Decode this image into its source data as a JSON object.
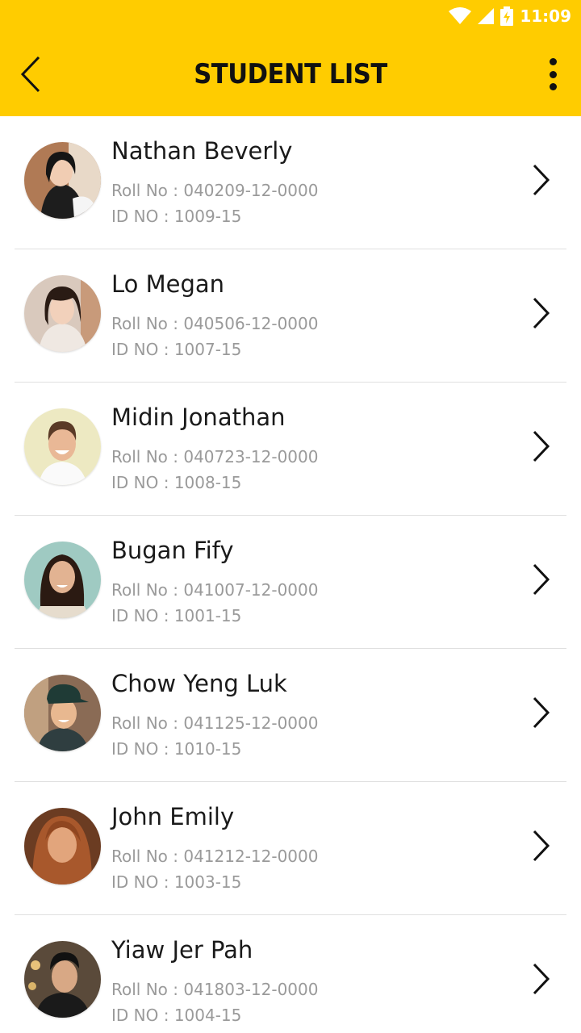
{
  "status_bar": {
    "time": "11:09"
  },
  "header": {
    "title": "STUDENT LIST",
    "accent_color": "#FFCC00"
  },
  "icons": {
    "back": "chevron-left-icon",
    "more": "more-vert-icon",
    "row_action": "chevron-right-icon",
    "wifi": "wifi-icon",
    "signal": "signal-icon",
    "battery": "battery-charging-icon"
  },
  "students": [
    {
      "name": "Nathan Beverly",
      "roll": "Roll No : 040209-12-0000",
      "id": "ID NO : 1009-15"
    },
    {
      "name": "Lo Megan",
      "roll": "Roll No : 040506-12-0000",
      "id": "ID NO : 1007-15"
    },
    {
      "name": "Midin Jonathan",
      "roll": "Roll No : 040723-12-0000",
      "id": "ID NO : 1008-15"
    },
    {
      "name": "Bugan Fify",
      "roll": "Roll No : 041007-12-0000",
      "id": "ID NO : 1001-15"
    },
    {
      "name": "Chow Yeng Luk",
      "roll": "Roll No : 041125-12-0000",
      "id": "ID NO : 1010-15"
    },
    {
      "name": "John Emily",
      "roll": "Roll No : 041212-12-0000",
      "id": "ID NO : 1003-15"
    },
    {
      "name": "Yiaw Jer Pah",
      "roll": "Roll No : 041803-12-0000",
      "id": "ID NO : 1004-15"
    }
  ]
}
